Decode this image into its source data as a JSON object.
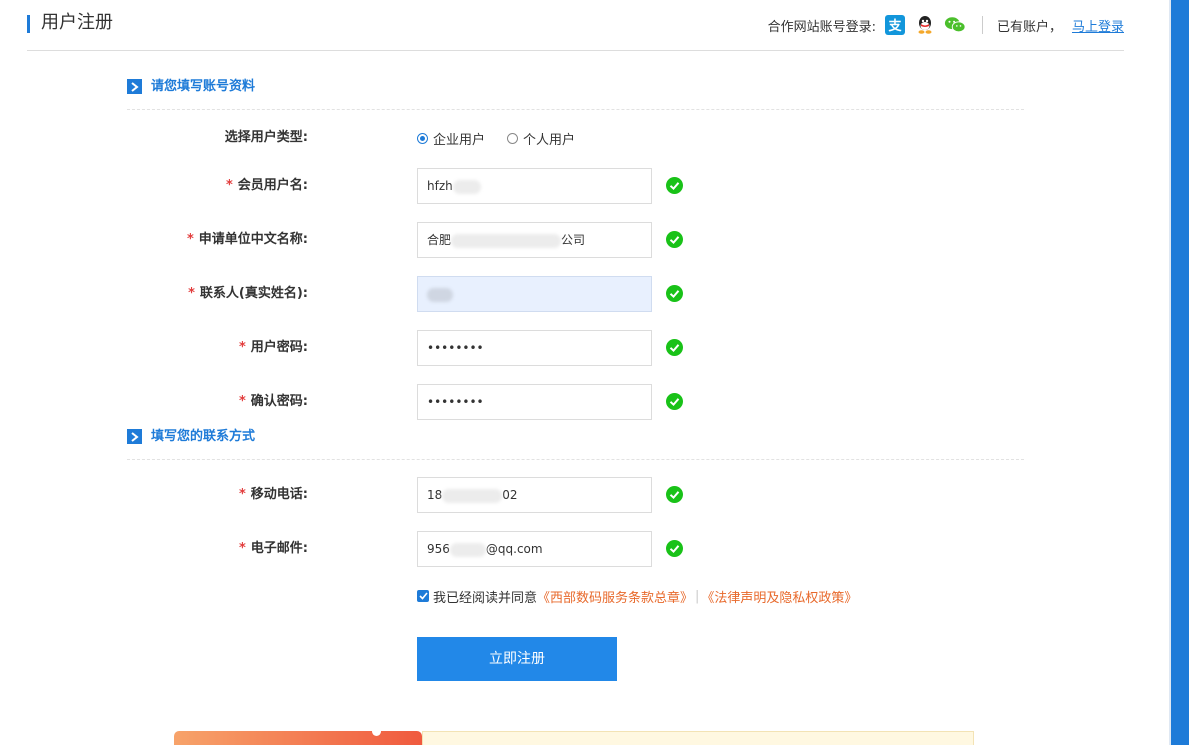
{
  "header": {
    "title": "用户注册",
    "partner_login_label": "合作网站账号登录:",
    "has_account_text": "已有账户，",
    "login_link": "马上登录",
    "sns": [
      "alipay-icon",
      "qq-icon",
      "wechat-icon"
    ]
  },
  "section1": {
    "title": "请您填写账号资料"
  },
  "section2": {
    "title": "填写您的联系方式"
  },
  "user_type": {
    "label": "选择用户类型:",
    "options": [
      "企业用户",
      "个人用户"
    ],
    "selected": "企业用户"
  },
  "fields": {
    "username": {
      "label": "会员用户名:",
      "value_prefix": "hfzh"
    },
    "company": {
      "label": "申请单位中文名称:",
      "value_prefix": "合肥",
      "value_suffix": "公司"
    },
    "contact": {
      "label": "联系人(真实姓名):"
    },
    "password": {
      "label": "用户密码:",
      "value": "••••••••"
    },
    "confirm": {
      "label": "确认密码:",
      "value": "••••••••"
    },
    "mobile": {
      "label": "移动电话:",
      "value_prefix": "18",
      "value_suffix": "02"
    },
    "email": {
      "label": "电子邮件:",
      "value_prefix": "956",
      "value_suffix": "@qq.com"
    }
  },
  "agreement": {
    "text": "我已经阅读并同意",
    "link1": "《西部数码服务条款总章》",
    "separator": "|",
    "link2": "《法律声明及隐私权政策》",
    "checked": true
  },
  "submit_label": "立即注册",
  "colors": {
    "accent": "#1e7bd8",
    "button": "#2288e8",
    "required": "#e23c3c",
    "link_orange": "#e8692b",
    "valid": "#19c218"
  }
}
